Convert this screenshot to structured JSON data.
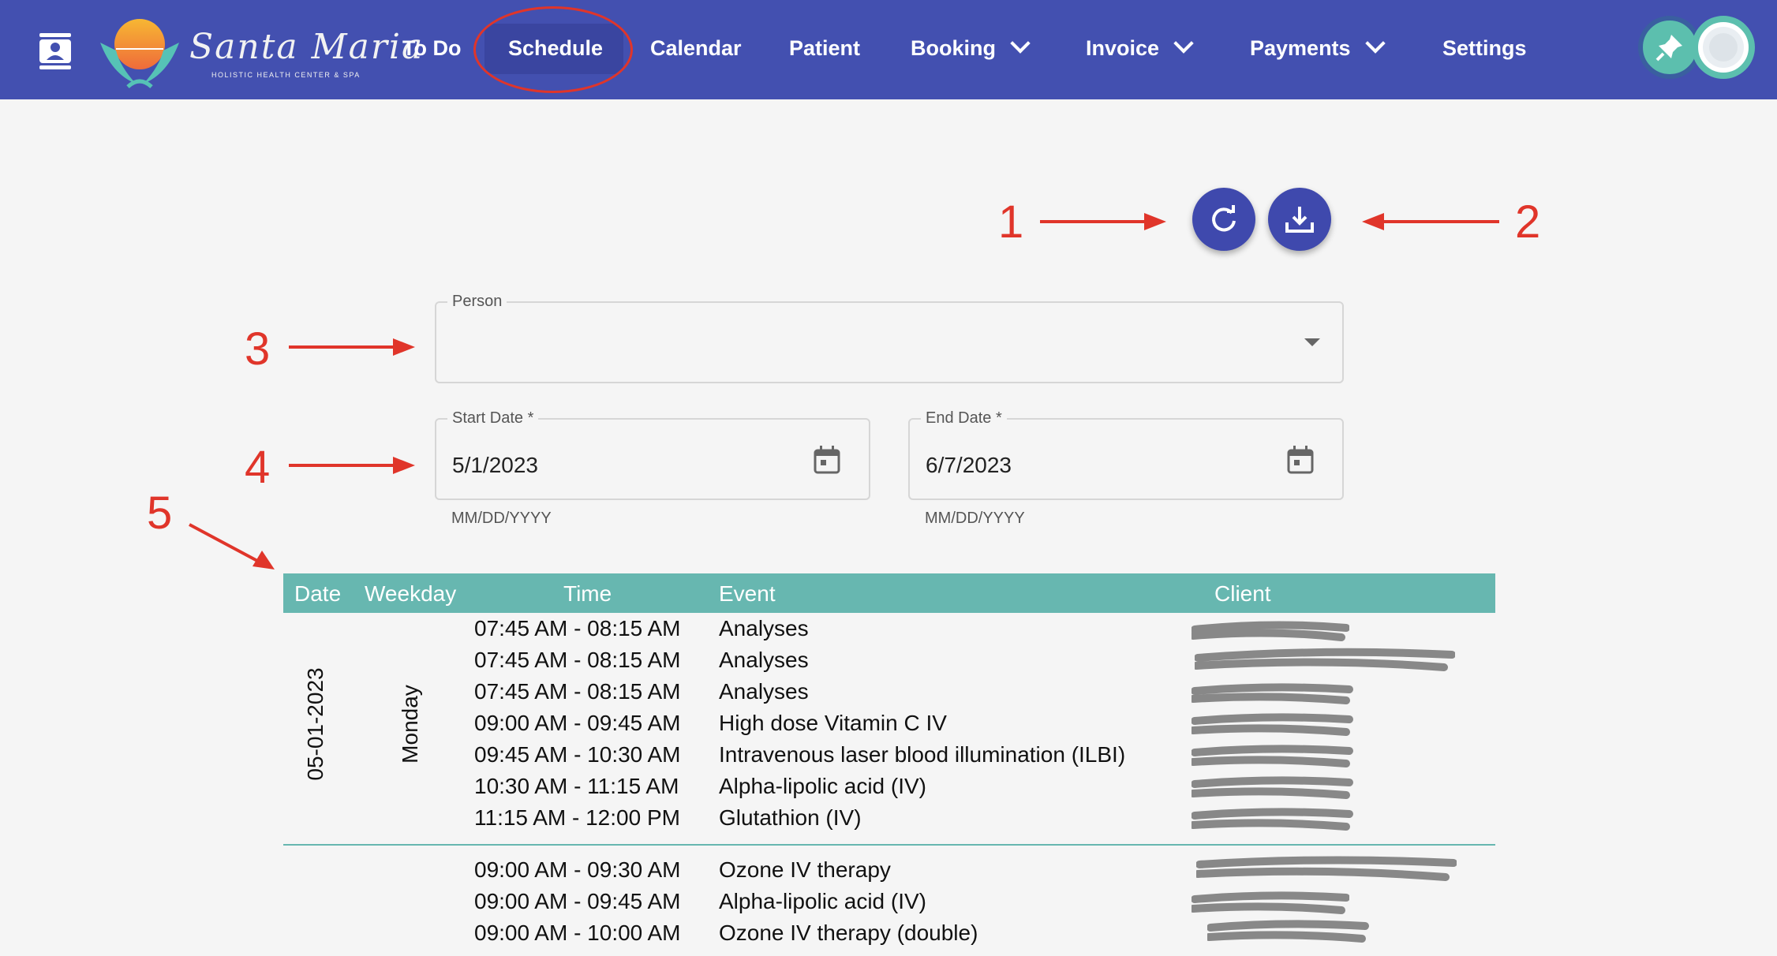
{
  "brand": {
    "name": "Santa Maria",
    "tagline": "HOLISTIC HEALTH CENTER & SPA"
  },
  "nav": {
    "items": [
      {
        "label": "To Do"
      },
      {
        "label": "Schedule"
      },
      {
        "label": "Calendar"
      },
      {
        "label": "Patient"
      },
      {
        "label": "Booking"
      },
      {
        "label": "Invoice"
      },
      {
        "label": "Payments"
      },
      {
        "label": "Settings"
      }
    ],
    "active": "Schedule"
  },
  "annotations": [
    "1",
    "2",
    "3",
    "4",
    "5"
  ],
  "form": {
    "person": {
      "label": "Person",
      "value": ""
    },
    "start_date": {
      "label": "Start Date *",
      "value": "5/1/2023",
      "helper": "MM/DD/YYYY"
    },
    "end_date": {
      "label": "End Date *",
      "value": "6/7/2023",
      "helper": "MM/DD/YYYY"
    }
  },
  "table": {
    "headers": [
      "Date",
      "Weekday",
      "Time",
      "Event",
      "Client"
    ],
    "group1": {
      "date": "05-01-2023",
      "weekday": "Monday",
      "rows": [
        {
          "time": "07:45 AM - 08:15 AM",
          "event": "Analyses"
        },
        {
          "time": "07:45 AM - 08:15 AM",
          "event": "Analyses"
        },
        {
          "time": "07:45 AM - 08:15 AM",
          "event": "Analyses"
        },
        {
          "time": "09:00 AM - 09:45 AM",
          "event": "High dose Vitamin C IV"
        },
        {
          "time": "09:45 AM - 10:30 AM",
          "event": "Intravenous laser blood illumination (ILBI)"
        },
        {
          "time": "10:30 AM - 11:15 AM",
          "event": "Alpha-lipolic acid (IV)"
        },
        {
          "time": "11:15 AM - 12:00 PM",
          "event": "Glutathion (IV)"
        }
      ]
    },
    "group2": {
      "rows": [
        {
          "time": "09:00 AM - 09:30 AM",
          "event": "Ozone IV therapy"
        },
        {
          "time": "09:00 AM - 09:45 AM",
          "event": "Alpha-lipolic acid (IV)"
        },
        {
          "time": "09:00 AM - 10:00 AM",
          "event": "Ozone IV therapy (double)"
        }
      ]
    }
  },
  "colors": {
    "nav_bg": "#4350b0",
    "accent": "#3f49ad",
    "table_header": "#67b7b0",
    "annotation": "#e0352a"
  }
}
